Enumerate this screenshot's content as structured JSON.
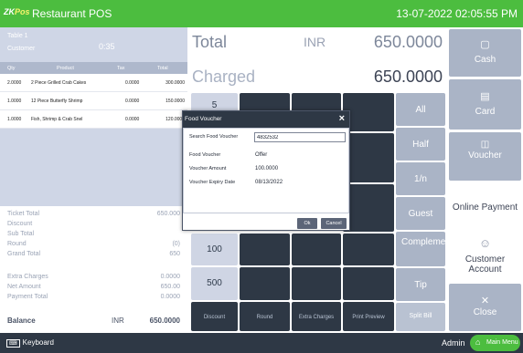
{
  "app": {
    "logo_prefix": "ZK",
    "logo_suffix": "Pos",
    "title": "Restaurant POS",
    "clock": "13-07-2022 02:05:55 PM"
  },
  "ticket": {
    "label_1": "Table 1",
    "label_2": "Customer",
    "label_3": "0:35",
    "columns": [
      "Qty",
      "Product",
      "Tax",
      "Total"
    ],
    "items": [
      {
        "qty": "2.0000",
        "product": "2 Piece Grilled Crab Cakes",
        "tax": "0.0000",
        "total": "300.0000"
      },
      {
        "qty": "1.0000",
        "product": "12 Piece Butterfly Shrimp",
        "tax": "0.0000",
        "total": "150.0000"
      },
      {
        "qty": "1.0000",
        "product": "Fish, Shrimp & Crab Snel",
        "tax": "0.0000",
        "total": "120.0000"
      }
    ]
  },
  "summary": [
    {
      "label": "Ticket Total",
      "value": "650.000"
    },
    {
      "label": "Discount",
      "value": ""
    },
    {
      "label": "Sub Total",
      "value": ""
    },
    {
      "label": "Round",
      "value": "(0)"
    },
    {
      "label": "Grand Total",
      "value": "650"
    },
    {
      "label": "Extra Charges",
      "value": "0.0000"
    },
    {
      "label": "Net Amount",
      "value": "650.00"
    },
    {
      "label": "Payment Total",
      "value": "0.0000"
    }
  ],
  "balance": {
    "label": "Balance",
    "currency": "INR",
    "value": "650.0000"
  },
  "totals": {
    "total_label": "Total",
    "currency": "INR",
    "total_value": "650.0000",
    "charged_label": "Charged",
    "charged_value": "650.0000"
  },
  "keypad": {
    "amount_keys": [
      "5",
      "100",
      "500"
    ],
    "bottom_keys": [
      "Discount",
      "Round",
      "Extra Charges",
      "Print Preview"
    ]
  },
  "right_keys": [
    "All",
    "Half",
    "1/n",
    "Guest",
    "Complementary",
    "Tip"
  ],
  "split_key": "Split Bill",
  "payment_methods": [
    {
      "label": "Cash",
      "icon": "cash-icon"
    },
    {
      "label": "Card",
      "icon": "card-icon"
    },
    {
      "label": "Voucher",
      "icon": "voucher-icon"
    },
    {
      "label": "Online Payment",
      "icon": ""
    },
    {
      "label": "Customer Account",
      "icon": "person-icon"
    },
    {
      "label": "Close",
      "icon": "close-icon"
    }
  ],
  "bottombar": {
    "keyboard_icon": "keyboard-icon",
    "keyboard_label": "Keyboard",
    "user": "Admin",
    "main_menu": "Main Menu",
    "main_menu_icon": "home-icon"
  },
  "dialog": {
    "title": "Food Voucher",
    "search_label": "Search Food Voucher",
    "search_value": "4832532",
    "fields": [
      {
        "label": "Food Voucher",
        "value": "Offer"
      },
      {
        "label": "Voucher Amount",
        "value": "100.0000"
      },
      {
        "label": "Voucher Expiry Date",
        "value": "08/13/2022"
      }
    ],
    "ok_label": "Ok",
    "cancel_label": "Cancel"
  },
  "colors": {
    "brand_green": "#4cbd3f",
    "dark": "#2e3845",
    "key_grey": "#aab4c6"
  }
}
